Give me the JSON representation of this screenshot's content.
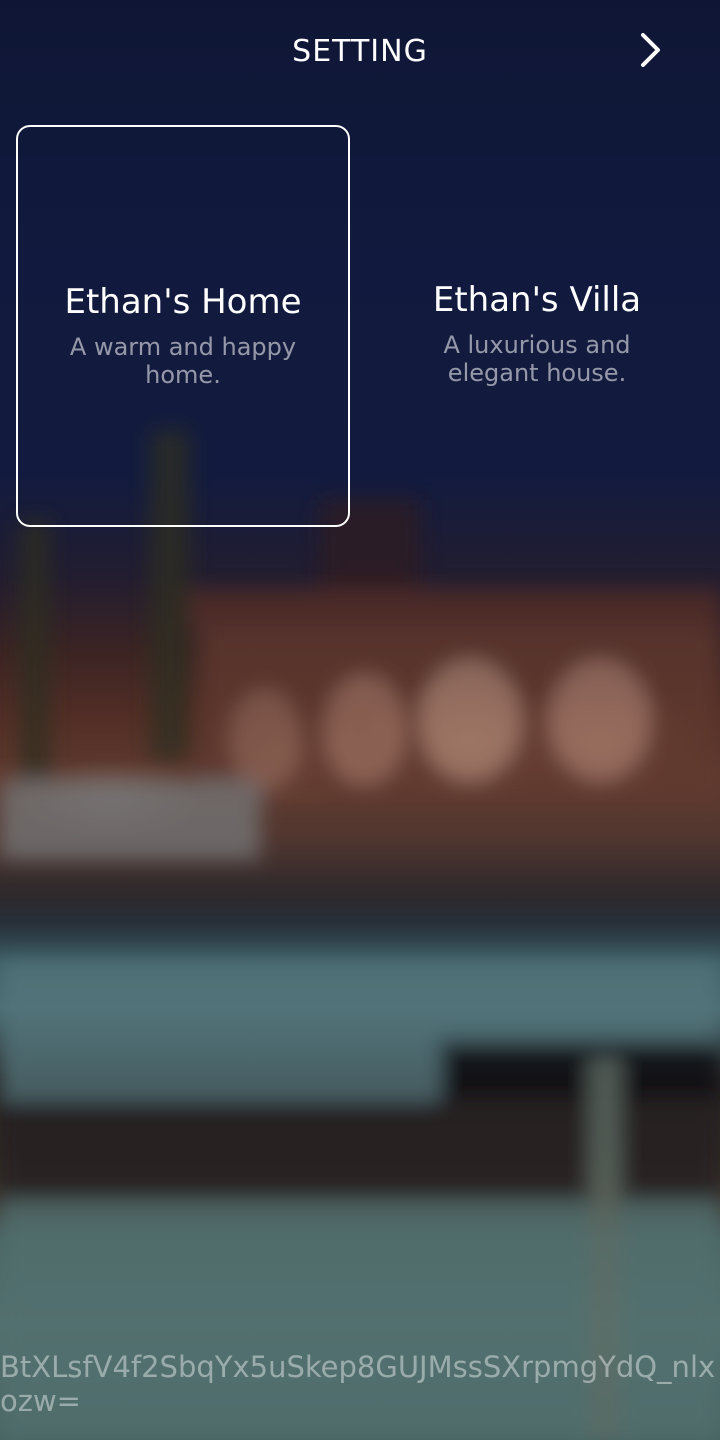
{
  "header": {
    "title": "SETTING",
    "next_icon": "chevron-right-icon"
  },
  "homes": [
    {
      "name": "Ethan's Home",
      "description": "A warm and happy home.",
      "selected": true
    },
    {
      "name": "Ethan's Villa",
      "description": "A luxurious and elegant house.",
      "selected": false
    }
  ],
  "footer": {
    "code": "BtXLsfV4f2SbqYx5uSkep8GUJMssSXrpmgYdQ_nlxozw="
  },
  "colors": {
    "text": "#ffffff",
    "selection_border": "#ffffff"
  }
}
